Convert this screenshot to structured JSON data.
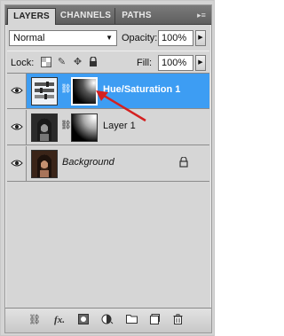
{
  "tabs": [
    {
      "label": "LAYERS",
      "active": true
    },
    {
      "label": "CHANNELS",
      "active": false
    },
    {
      "label": "PATHS",
      "active": false
    }
  ],
  "blend_mode": "Normal",
  "opacity": {
    "label": "Opacity:",
    "value": "100%"
  },
  "lock": {
    "label": "Lock:"
  },
  "fill": {
    "label": "Fill:",
    "value": "100%"
  },
  "layers": [
    {
      "name": "Hue/Saturation 1",
      "selected": true,
      "style": "bold"
    },
    {
      "name": "Layer 1",
      "selected": false,
      "style": "normal"
    },
    {
      "name": "Background",
      "selected": false,
      "style": "italic"
    }
  ],
  "colors": {
    "selection": "#3d9df3",
    "annotation_arrow": "#d42020"
  },
  "bottom_icons": [
    "link-layers-icon",
    "fx-icon",
    "add-mask-icon",
    "adjustment-layer-icon",
    "group-folder-icon",
    "new-layer-icon",
    "trash-icon"
  ],
  "fx_label": "fx."
}
